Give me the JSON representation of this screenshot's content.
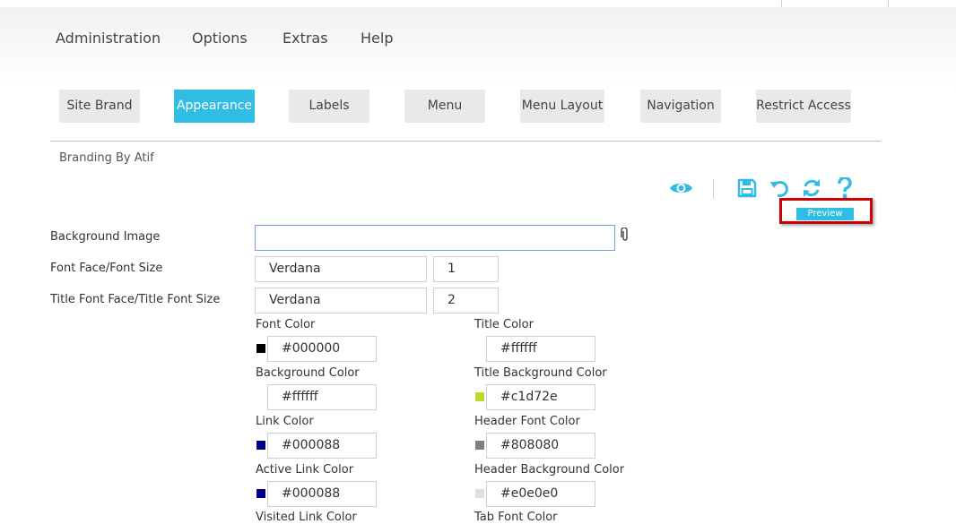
{
  "top_menu": {
    "items": [
      {
        "label": "Administration"
      },
      {
        "label": "Options"
      },
      {
        "label": "Extras"
      },
      {
        "label": "Help"
      }
    ]
  },
  "tabs": [
    {
      "label": "Site Brand",
      "active": false
    },
    {
      "label": "Appearance",
      "active": true
    },
    {
      "label": "Labels",
      "active": false
    },
    {
      "label": "Menu",
      "active": false
    },
    {
      "label": "Menu Layout",
      "active": false
    },
    {
      "label": "Navigation",
      "active": false
    },
    {
      "label": "Restrict Access",
      "active": false
    }
  ],
  "brand_caption": "Branding By Atif",
  "toolbar": {
    "icons": [
      "eye-icon",
      "save-icon",
      "undo-icon",
      "refresh-icon",
      "help-icon"
    ],
    "preview_label": "Preview",
    "icon_color": "#30bde3",
    "highlight_color": "#cc0000"
  },
  "form": {
    "background_image": {
      "label": "Background Image",
      "value": ""
    },
    "font": {
      "label": "Font Face/Font Size",
      "face": "Verdana",
      "size": "1"
    },
    "title_font": {
      "label": "Title Font Face/Title Font Size",
      "face": "Verdana",
      "size": "2"
    }
  },
  "colors": {
    "font_color": {
      "label": "Font Color",
      "value": "#000000",
      "swatch": "#000000"
    },
    "title_color": {
      "label": "Title Color",
      "value": "#ffffff",
      "swatch": "#ffffff"
    },
    "background_color": {
      "label": "Background Color",
      "value": "#ffffff",
      "swatch": "#ffffff"
    },
    "title_background_color": {
      "label": "Title Background Color",
      "value": "#c1d72e",
      "swatch": "#c1d72e"
    },
    "link_color": {
      "label": "Link Color",
      "value": "#000088",
      "swatch": "#000088"
    },
    "header_font_color": {
      "label": "Header Font Color",
      "value": "#808080",
      "swatch": "#808080"
    },
    "active_link_color": {
      "label": "Active Link Color",
      "value": "#000088",
      "swatch": "#000088"
    },
    "header_background_color": {
      "label": "Header Background Color",
      "value": "#e0e0e0",
      "swatch": "#e0e0e0"
    },
    "visited_link_color": {
      "label": "Visited Link Color"
    },
    "tab_font_color": {
      "label": "Tab Font Color"
    }
  }
}
